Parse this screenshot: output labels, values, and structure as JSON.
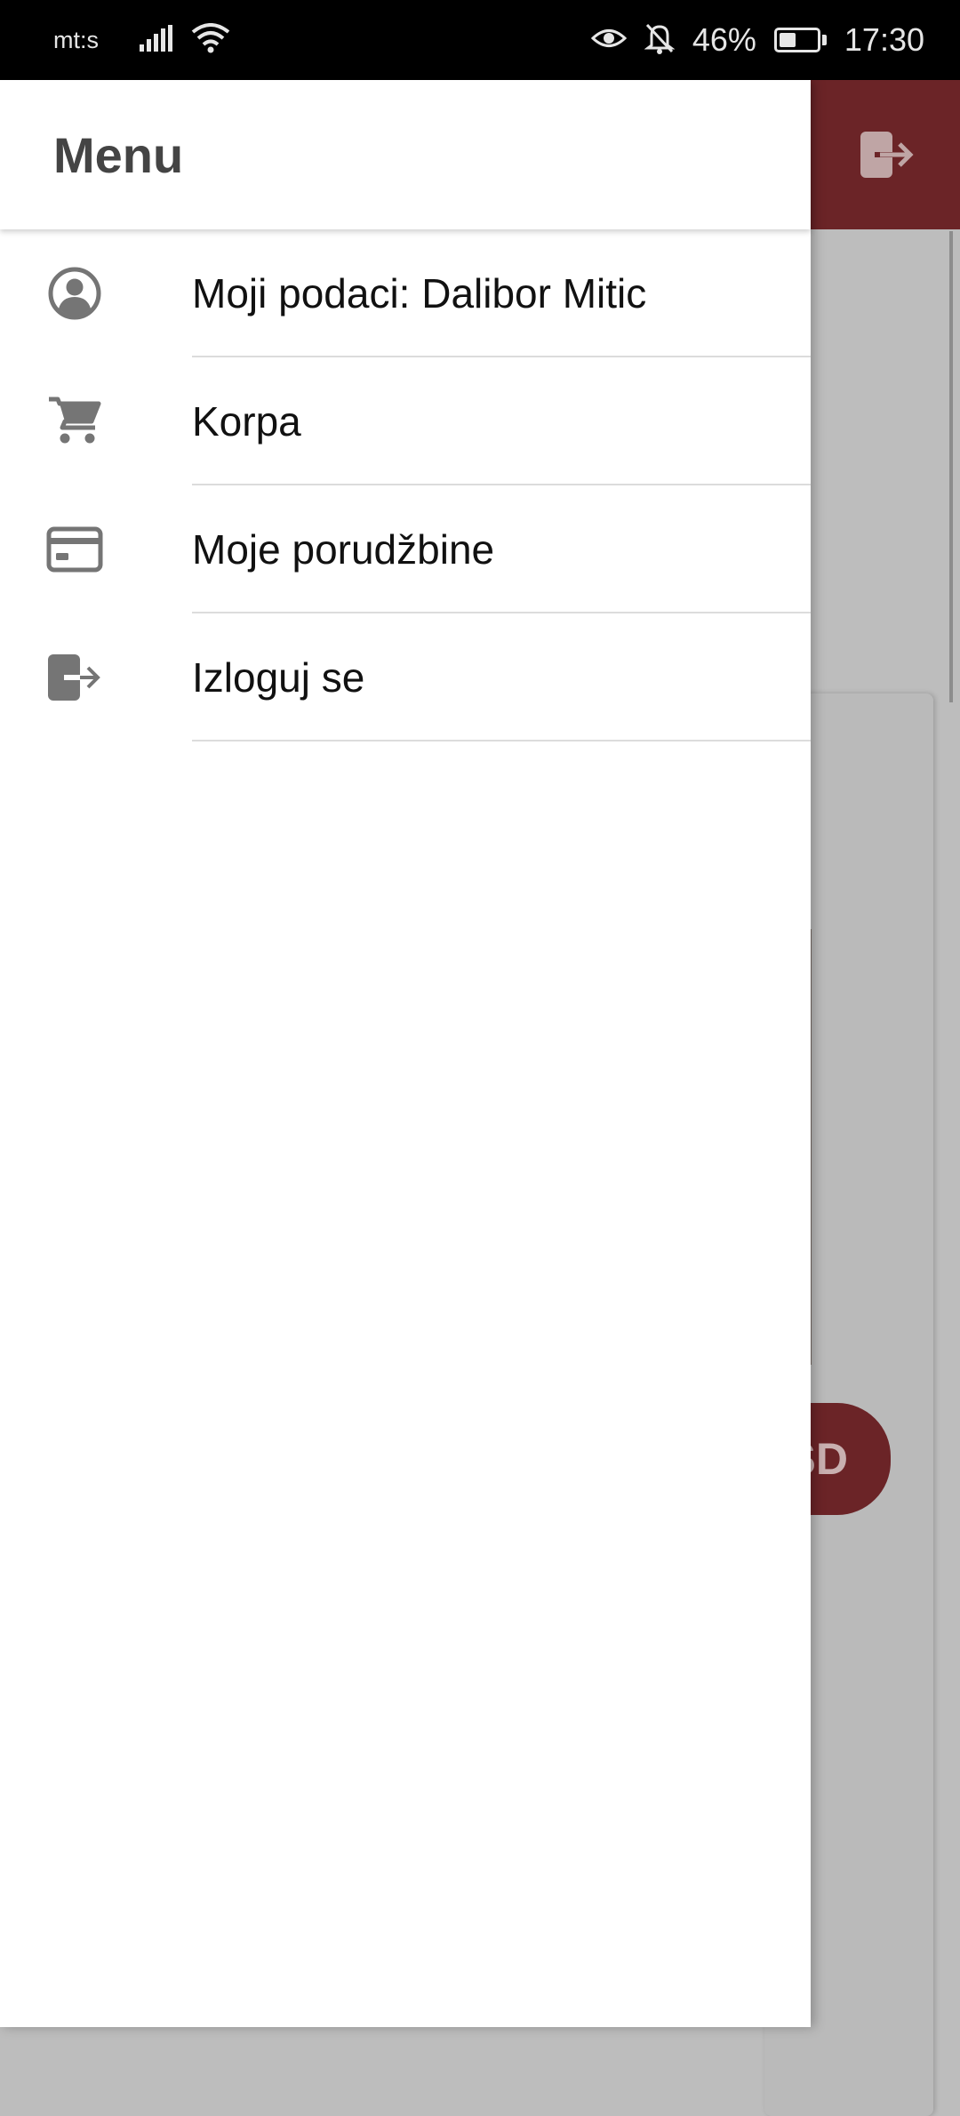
{
  "status_bar": {
    "carrier": "mt:s",
    "battery_percent": "46%",
    "battery_level": 0.46,
    "time": "17:30"
  },
  "drawer": {
    "title": "Menu",
    "items": [
      {
        "label": "Moji podaci: Dalibor Mitic",
        "icon": "account-circle-icon"
      },
      {
        "label": "Korpa",
        "icon": "cart-icon"
      },
      {
        "label": "Moje porudžbine",
        "icon": "credit-card-icon"
      },
      {
        "label": "Izloguj se",
        "icon": "logout-icon"
      }
    ]
  },
  "background_screen": {
    "appbar_icon": "logout-icon",
    "partial_button_text": "SD",
    "accent_color": "#6b2427"
  },
  "colors": {
    "icon": "#757575",
    "text": "#111111",
    "title": "#444444",
    "divider": "#dcdcdc"
  }
}
